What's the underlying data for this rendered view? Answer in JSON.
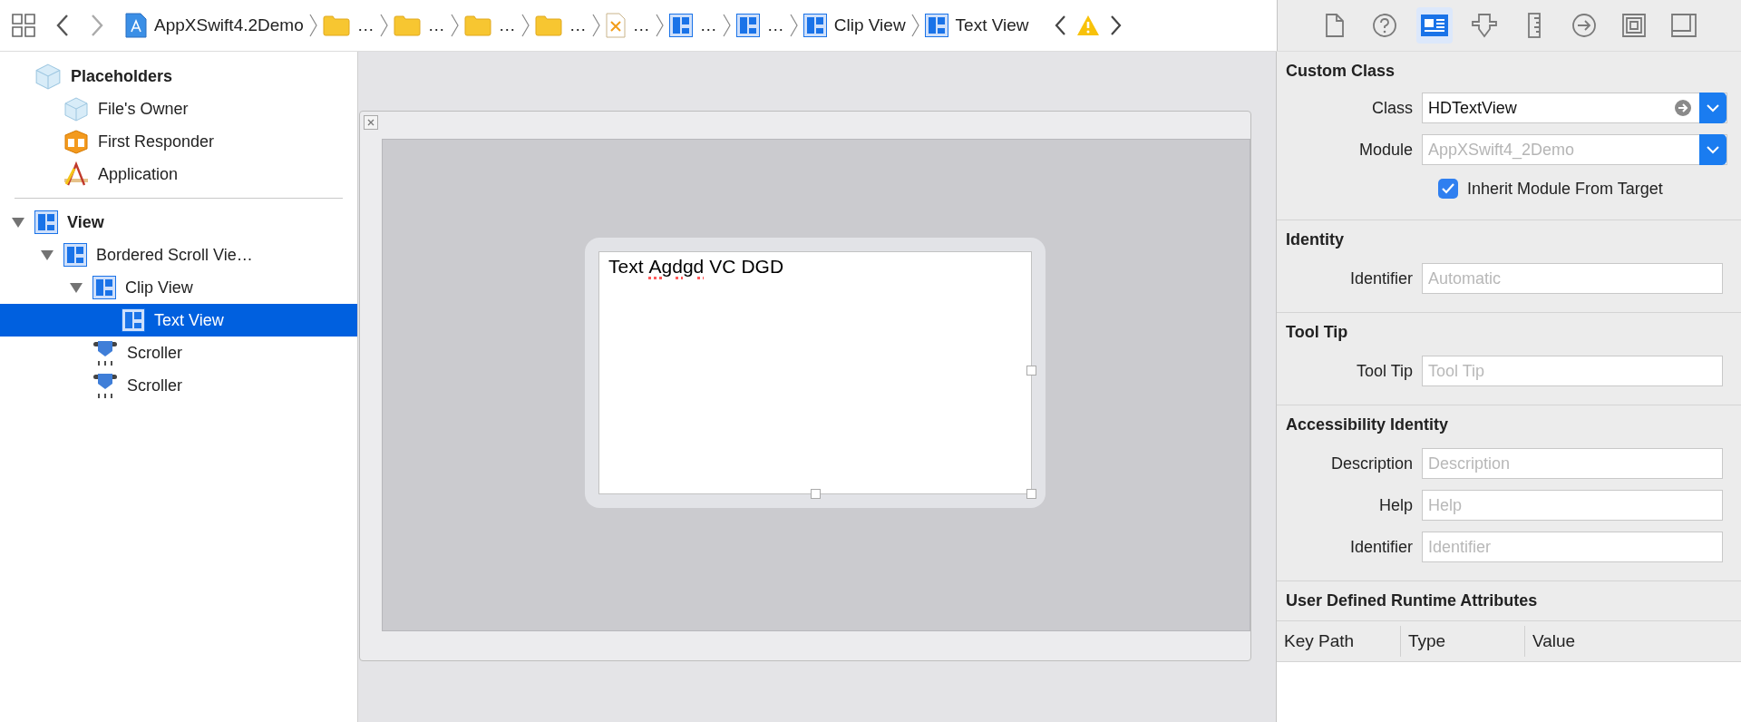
{
  "toolbar": {
    "breadcrumb": [
      {
        "kind": "project",
        "label": "AppXSwift4.2Demo"
      },
      {
        "kind": "folder",
        "label": "…"
      },
      {
        "kind": "folder",
        "label": "…"
      },
      {
        "kind": "folder",
        "label": "…"
      },
      {
        "kind": "folder",
        "label": "…"
      },
      {
        "kind": "xib",
        "label": "…"
      },
      {
        "kind": "view",
        "label": "…"
      },
      {
        "kind": "view",
        "label": "…"
      },
      {
        "kind": "view",
        "label": "Clip View"
      },
      {
        "kind": "view",
        "label": "Text View"
      }
    ]
  },
  "inspector_tabs": [
    {
      "kind": "file",
      "selected": false
    },
    {
      "kind": "help",
      "selected": false
    },
    {
      "kind": "identity",
      "selected": true
    },
    {
      "kind": "attributes",
      "selected": false
    },
    {
      "kind": "size",
      "selected": false
    },
    {
      "kind": "connections",
      "selected": false
    },
    {
      "kind": "bindings",
      "selected": false
    },
    {
      "kind": "effects",
      "selected": false
    }
  ],
  "outline": [
    {
      "kind": "placeholder",
      "label": "Placeholders",
      "selected": false,
      "children": [
        {
          "kind": "owner",
          "label": "File's Owner",
          "selected": false
        },
        {
          "kind": "responder",
          "label": "First Responder",
          "selected": false
        },
        {
          "kind": "application",
          "label": "Application",
          "selected": false
        }
      ]
    },
    {
      "kind": "view",
      "label": "View",
      "selected": false,
      "expanded": true,
      "children": [
        {
          "kind": "view",
          "label": "Bordered Scroll Vie…",
          "selected": false,
          "expanded": true,
          "children": [
            {
              "kind": "view",
              "label": "Clip View",
              "selected": false,
              "expanded": true,
              "children": [
                {
                  "kind": "view",
                  "label": "Text View",
                  "selected": true
                }
              ]
            },
            {
              "kind": "scroller",
              "label": "Scroller",
              "selected": false
            },
            {
              "kind": "scroller",
              "label": "Scroller",
              "selected": false
            }
          ]
        }
      ]
    }
  ],
  "canvas": {
    "words": [
      {
        "text": "Text",
        "misspelled": false
      },
      {
        "text": "Agdgd",
        "misspelled": true
      },
      {
        "text": "VC",
        "misspelled": false
      },
      {
        "text": "DGD",
        "misspelled": false
      }
    ]
  },
  "inspector": {
    "sections": [
      {
        "title": "Custom Class",
        "fields": [
          {
            "kind": "combo",
            "label": "Class",
            "value": "HDTextView"
          },
          {
            "kind": "combo",
            "label": "Module",
            "placeholder": "AppXSwift4_2Demo"
          },
          {
            "kind": "checkbox",
            "label": "Inherit Module From Target",
            "checked": true
          }
        ]
      },
      {
        "title": "Identity",
        "fields": [
          {
            "kind": "text",
            "label": "Identifier",
            "placeholder": "Automatic"
          }
        ]
      },
      {
        "title": "Tool Tip",
        "fields": [
          {
            "kind": "text",
            "label": "Tool Tip",
            "placeholder": "Tool Tip"
          }
        ]
      },
      {
        "title": "Accessibility Identity",
        "fields": [
          {
            "kind": "text",
            "label": "Description",
            "placeholder": "Description"
          },
          {
            "kind": "text",
            "label": "Help",
            "placeholder": "Help"
          },
          {
            "kind": "text",
            "label": "Identifier",
            "placeholder": "Identifier"
          }
        ]
      },
      {
        "title": "User Defined Runtime Attributes",
        "columns": [
          "Key Path",
          "Type",
          "Value"
        ]
      }
    ]
  }
}
